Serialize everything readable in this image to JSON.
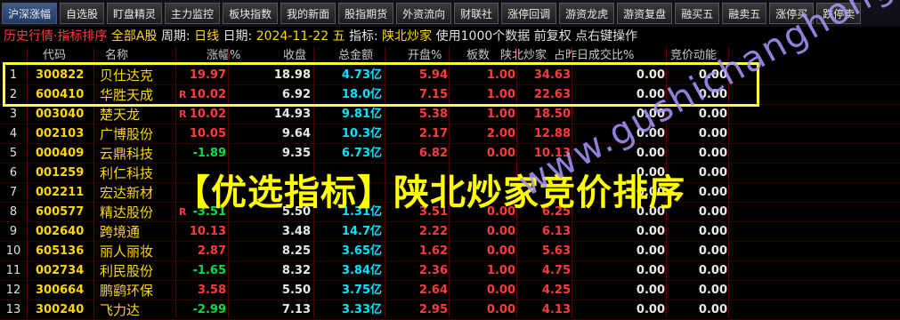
{
  "toolbar": {
    "buttons": [
      "沪深涨幅",
      "自选股",
      "盯盘精灵",
      "主力监控",
      "板块指数",
      "我的新面",
      "股指期货",
      "外资流向",
      "财联社",
      "涨停回调",
      "游资龙虎",
      "游资复盘",
      "融买五",
      "融卖五",
      "涨停买",
      "跌停卖"
    ]
  },
  "info": {
    "title": "历史行情·指标排序",
    "scope": "全部A股",
    "period_label": "周期:",
    "period_value": "日线",
    "date_label": "日期:",
    "date_value": "2024-11-22 五",
    "indicator_label": "指标:",
    "indicator_value": "陕北炒家",
    "note": "使用1000个数据 前复权 点右键操作"
  },
  "columns": [
    "代码",
    "名称",
    "涨幅%",
    "收盘",
    "总金额",
    "开盘%",
    "板数",
    "陕北炒家",
    "占昨日成交比%",
    "竞价动能"
  ],
  "rows": [
    {
      "n": "1",
      "code": "300822",
      "name": "贝仕达克",
      "flag": "",
      "chg": "19.97",
      "dir": "up",
      "close": "18.98",
      "amt": "4.73亿",
      "open": "5.94",
      "idx": "1.00",
      "sbcj": "34.63",
      "ratio": "0.00",
      "jjdn": "0.00"
    },
    {
      "n": "2",
      "code": "600410",
      "name": "华胜天成",
      "flag": "R",
      "chg": "10.02",
      "dir": "up",
      "close": "6.92",
      "amt": "18.0亿",
      "open": "7.15",
      "idx": "1.00",
      "sbcj": "22.63",
      "ratio": "0.00",
      "jjdn": "0.00"
    },
    {
      "n": "3",
      "code": "003040",
      "name": "楚天龙",
      "flag": "R",
      "chg": "10.02",
      "dir": "up",
      "close": "14.93",
      "amt": "9.81亿",
      "open": "5.38",
      "idx": "1.00",
      "sbcj": "18.50",
      "ratio": "0.00",
      "jjdn": "0.00"
    },
    {
      "n": "4",
      "code": "002103",
      "name": "广博股份",
      "flag": "",
      "chg": "10.05",
      "dir": "up",
      "close": "9.64",
      "amt": "10.3亿",
      "open": "2.17",
      "idx": "2.00",
      "sbcj": "12.88",
      "ratio": "0.00",
      "jjdn": "0.00"
    },
    {
      "n": "5",
      "code": "000409",
      "name": "云鼎科技",
      "flag": "",
      "chg": "-1.89",
      "dir": "down",
      "close": "9.35",
      "amt": "6.73亿",
      "open": "6.82",
      "idx": "0.00",
      "sbcj": "10.13",
      "ratio": "0.00",
      "jjdn": "0.00"
    },
    {
      "n": "6",
      "code": "001259",
      "name": "利仁科技",
      "flag": "",
      "chg": "",
      "dir": "up",
      "close": "",
      "amt": "",
      "open": "",
      "idx": "",
      "sbcj": "",
      "ratio": "0.00",
      "jjdn": "0.00"
    },
    {
      "n": "7",
      "code": "002211",
      "name": "宏达新材",
      "flag": "",
      "chg": "",
      "dir": "up",
      "close": "",
      "amt": "",
      "open": "",
      "idx": "",
      "sbcj": "",
      "ratio": "0.00",
      "jjdn": "0.00"
    },
    {
      "n": "8",
      "code": "600577",
      "name": "精达股份",
      "flag": "R",
      "chg": "-3.51",
      "dir": "down",
      "close": "5.50",
      "amt": "1.31亿",
      "open": "3.51",
      "idx": "0.00",
      "sbcj": "6.25",
      "ratio": "0.00",
      "jjdn": "0.00"
    },
    {
      "n": "9",
      "code": "002640",
      "name": "跨境通",
      "flag": "",
      "chg": "10.13",
      "dir": "up",
      "close": "3.48",
      "amt": "14.7亿",
      "open": "2.22",
      "idx": "0.00",
      "sbcj": "6.13",
      "ratio": "0.00",
      "jjdn": "0.00"
    },
    {
      "n": "10",
      "code": "605136",
      "name": "丽人丽妆",
      "flag": "",
      "chg": "2.87",
      "dir": "up",
      "close": "8.25",
      "amt": "3.65亿",
      "open": "1.62",
      "idx": "0.00",
      "sbcj": "5.63",
      "ratio": "0.00",
      "jjdn": "0.00"
    },
    {
      "n": "11",
      "code": "002734",
      "name": "利民股份",
      "flag": "",
      "chg": "-1.65",
      "dir": "down",
      "close": "8.32",
      "amt": "3.84亿",
      "open": "2.36",
      "idx": "1.00",
      "sbcj": "4.75",
      "ratio": "0.00",
      "jjdn": "0.00"
    },
    {
      "n": "12",
      "code": "300664",
      "name": "鹏鹞环保",
      "flag": "",
      "chg": "3.58",
      "dir": "up",
      "close": "5.50",
      "amt": "3.75亿",
      "open": "2.64",
      "idx": "0.00",
      "sbcj": "4.25",
      "ratio": "0.00",
      "jjdn": "0.00"
    },
    {
      "n": "13",
      "code": "300240",
      "name": "飞力达",
      "flag": "",
      "chg": "-2.99",
      "dir": "down",
      "close": "7.13",
      "amt": "3.33亿",
      "open": "2.95",
      "idx": "0.00",
      "sbcj": "4.13",
      "ratio": "0.00",
      "jjdn": "0.00"
    }
  ],
  "overlay": {
    "banner": "【优选指标】陕北炒家竞价排序",
    "watermark": "www.gushichanghong.com"
  },
  "colors": {
    "up": "#ff3b3b",
    "down": "#00e040",
    "code": "#ffd700",
    "amount": "#00e5ff",
    "highlight": "#ffff33"
  }
}
